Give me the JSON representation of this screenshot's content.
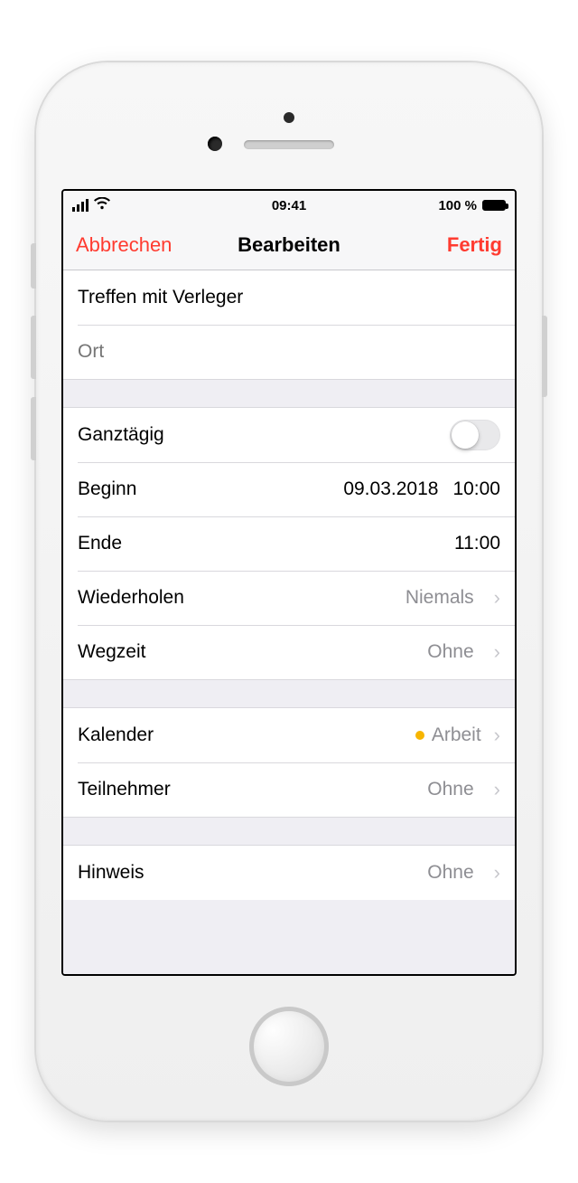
{
  "status": {
    "time": "09:41",
    "battery_text": "100 %"
  },
  "nav": {
    "cancel": "Abbrechen",
    "title": "Bearbeiten",
    "done": "Fertig"
  },
  "event": {
    "title_value": "Treffen mit Verleger",
    "location_placeholder": "Ort"
  },
  "rows": {
    "allday_label": "Ganztägig",
    "start_label": "Beginn",
    "start_date": "09.03.2018",
    "start_time": "10:00",
    "end_label": "Ende",
    "end_time": "11:00",
    "repeat_label": "Wiederholen",
    "repeat_value": "Niemals",
    "travel_label": "Wegzeit",
    "travel_value": "Ohne",
    "calendar_label": "Kalender",
    "calendar_value": "Arbeit",
    "calendar_color": "#f7b500",
    "invitees_label": "Teilnehmer",
    "invitees_value": "Ohne",
    "alert_label": "Hinweis",
    "alert_value": "Ohne"
  }
}
